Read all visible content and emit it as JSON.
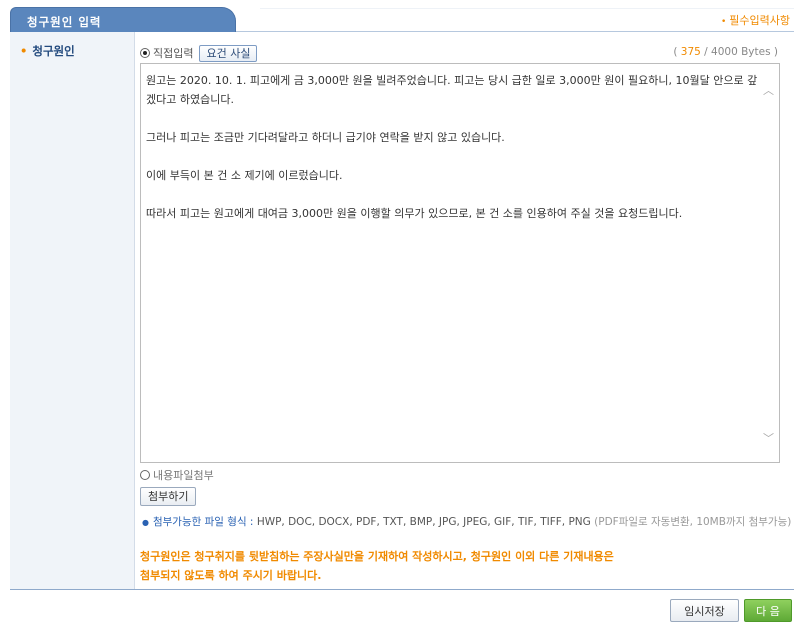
{
  "tab": {
    "title": "청구원인 입력"
  },
  "required_note": {
    "bullet": "•",
    "text": "필수입력사항"
  },
  "field": {
    "bullet": "•",
    "label": "청구원인"
  },
  "input_mode": {
    "direct_label": "직접입력",
    "facts_button": "요건 사실",
    "file_label": "내용파일첨부"
  },
  "byte_counter": {
    "open": "(",
    "count": "375",
    "rest": "/ 4000 Bytes )"
  },
  "textarea": {
    "paragraphs": [
      " 원고는 2020. 10. 1. 피고에게 금 3,000만 원을 빌려주었습니다. 피고는 당시 급한 일로 3,000만 원이 필요하니, 10월달 안으로 갚겠다고 하였습니다.",
      " 그러나 피고는 조금만 기다려달라고 하더니 급기야 연락을 받지 않고 있습니다.",
      " 이에 부득이 본 건 소 제기에 이르렀습니다.",
      " 따라서 피고는 원고에게 대여금 3,000만 원을 이행할 의무가 있으므로, 본 건 소를 인용하여 주실 것을 요청드립니다."
    ]
  },
  "attach": {
    "button": "첨부하기",
    "info_key": "첨부가능한 파일 형식 : ",
    "info_types": "HWP, DOC, DOCX, PDF, TXT, BMP, JPG, JPEG, GIF, TIF, TIFF, PNG",
    "info_note": " (PDF파일로 자동변환, 10MB까지 첨부가능)"
  },
  "warning": {
    "line1": "청구원인은 청구취지를 뒷받침하는 주장사실만을 기재하여 작성하시고, 청구원인 이외 다른 기재내용은",
    "line2": "첨부되지 않도록 하여 주시기 바랍니다."
  },
  "actions": {
    "temp_save": "임시저장",
    "next": "다 음"
  },
  "colors": {
    "tab_blue": "#5a86bd",
    "accent_orange": "#f08a00",
    "next_green": "#5ea936"
  },
  "icons": {
    "scroll_up": "chevron-up-icon",
    "scroll_down": "chevron-down-icon"
  }
}
